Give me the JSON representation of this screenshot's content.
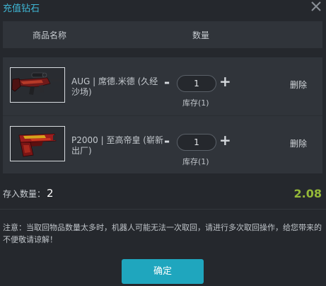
{
  "dialog": {
    "title": "充值钻石"
  },
  "table": {
    "col_name": "商品名称",
    "col_qty": "数量"
  },
  "items": [
    {
      "name": "AUG | 席德.米德 (久经沙场)",
      "qty": "1",
      "stock": "库存(1)",
      "delete": "删除",
      "minus": "-",
      "plus": "+"
    },
    {
      "name": "P2000 | 至高帝皇 (崭新出厂)",
      "qty": "1",
      "stock": "库存(1)",
      "delete": "删除",
      "minus": "-",
      "plus": "+"
    }
  ],
  "summary": {
    "deposit_label": "存入数量：",
    "deposit_count": "2",
    "total": "2.08"
  },
  "notice": "注意：当取回物品数量太多时，机器人可能无法一次取回，请进行多次取回操作，给您带来的不便敬请谅解！",
  "confirm_label": "确定",
  "colors": {
    "accent": "#3fb6d4",
    "total": "#94b838",
    "button": "#1fa6be"
  },
  "icons": {
    "close": "close-icon"
  }
}
